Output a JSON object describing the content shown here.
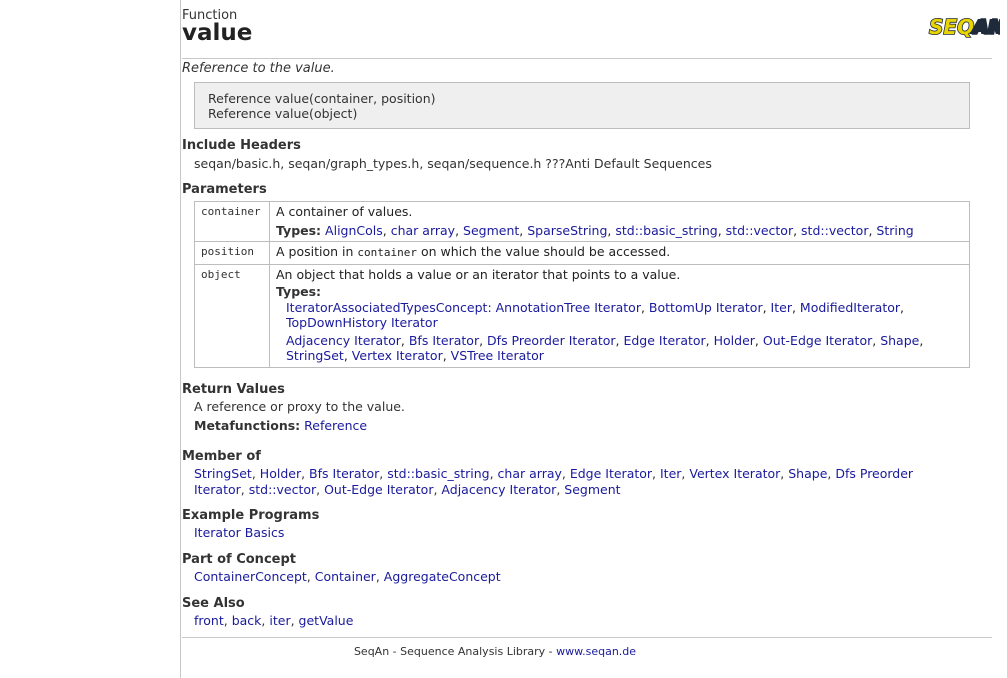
{
  "header": {
    "kind": "Function",
    "title": "value",
    "logo_text": "SEQAN",
    "summary": "Reference to the value."
  },
  "signatures": [
    "Reference value(container, position)",
    "Reference value(object)"
  ],
  "include_headers": {
    "title": "Include Headers",
    "text": "seqan/basic.h, seqan/graph_types.h, seqan/sequence.h ???Anti Default Sequences"
  },
  "parameters": {
    "title": "Parameters",
    "container": {
      "name": "container",
      "desc": "A container of values.",
      "types_label": "Types:",
      "types": [
        "AlignCols",
        "char array",
        "Segment",
        "SparseString",
        "std::basic_string",
        "std::vector",
        "std::vector",
        "String"
      ]
    },
    "position": {
      "name": "position",
      "desc_pre": "A position in",
      "desc_code": "container",
      "desc_post": "on which the value should be accessed."
    },
    "object": {
      "name": "object",
      "desc": "An object that holds a value or an iterator that points to a value.",
      "types_label": "Types:",
      "types_line1": [
        "IteratorAssociatedTypesConcept: AnnotationTree Iterator",
        "BottomUp Iterator",
        "Iter",
        "ModifiedIterator",
        "TopDownHistory Iterator"
      ],
      "types_line2": [
        "Adjacency Iterator",
        "Bfs Iterator",
        "Dfs Preorder Iterator",
        "Edge Iterator",
        "Holder",
        "Out-Edge Iterator",
        "Shape",
        "StringSet",
        "Vertex Iterator",
        "VSTree Iterator"
      ]
    }
  },
  "return_values": {
    "title": "Return Values",
    "text": "A reference or proxy to the value.",
    "metafunctions_label": "Metafunctions:",
    "metafunctions": [
      "Reference"
    ]
  },
  "member_of": {
    "title": "Member of",
    "items": [
      "StringSet",
      "Holder",
      "Bfs Iterator",
      "std::basic_string",
      "char array",
      "Edge Iterator",
      "Iter",
      "Vertex Iterator",
      "Shape",
      "Dfs Preorder Iterator",
      "std::vector",
      "Out-Edge Iterator",
      "Adjacency Iterator",
      "Segment"
    ]
  },
  "example_programs": {
    "title": "Example Programs",
    "items": [
      "Iterator Basics"
    ]
  },
  "part_of_concept": {
    "title": "Part of Concept",
    "items": [
      "ContainerConcept",
      "Container",
      "AggregateConcept"
    ]
  },
  "see_also": {
    "title": "See Also",
    "items": [
      "front",
      "back",
      "iter",
      "getValue"
    ]
  },
  "footer": {
    "text": "SeqAn - Sequence Analysis Library - ",
    "link": "www.seqan.de"
  },
  "colors": {
    "link": "#1a1a9c",
    "logo_yellow": "#e8d400",
    "logo_dark": "#1f2a3a",
    "sig_bg": "#efefef"
  }
}
